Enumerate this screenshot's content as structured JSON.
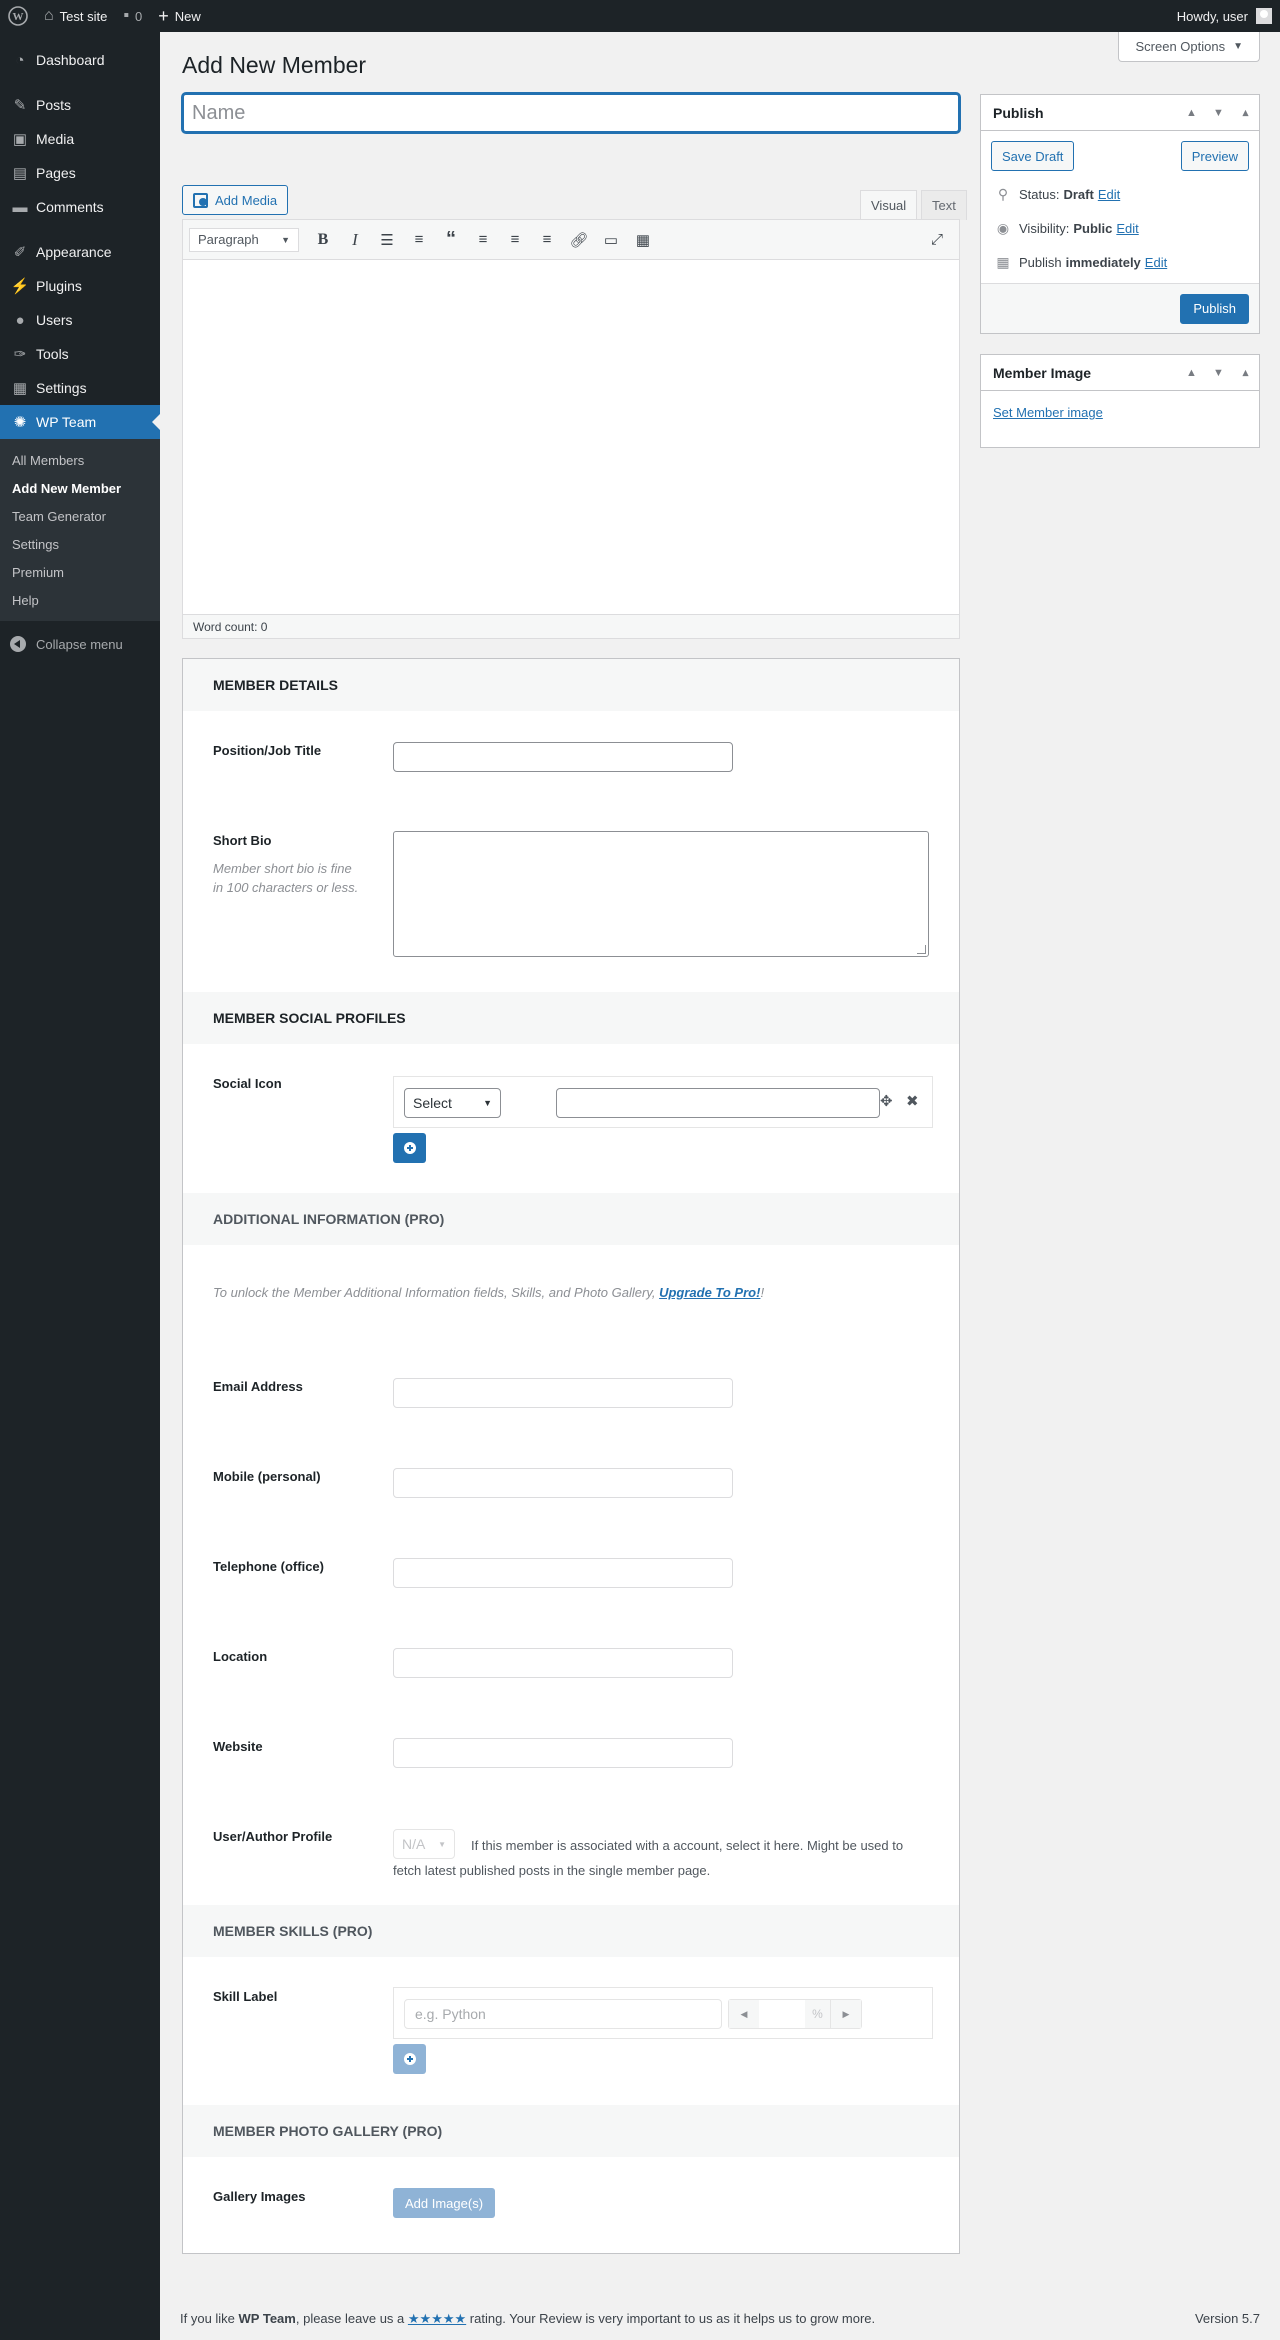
{
  "admin_bar": {
    "site_name": "Test site",
    "comments_count": "0",
    "new_label": "New",
    "howdy": "Howdy, user"
  },
  "menu": {
    "items": [
      {
        "label": "Dashboard",
        "icon": "dashboard-icon"
      },
      {
        "label": "Posts",
        "icon": "pin-icon"
      },
      {
        "label": "Media",
        "icon": "media-icon"
      },
      {
        "label": "Pages",
        "icon": "pages-icon"
      },
      {
        "label": "Comments",
        "icon": "comments-icon"
      },
      {
        "label": "Appearance",
        "icon": "brush-icon"
      },
      {
        "label": "Plugins",
        "icon": "plugin-icon"
      },
      {
        "label": "Users",
        "icon": "users-icon"
      },
      {
        "label": "Tools",
        "icon": "wrench-icon"
      },
      {
        "label": "Settings",
        "icon": "settings-icon"
      },
      {
        "label": "WP Team",
        "icon": "team-icon"
      }
    ],
    "submenu": [
      "All Members",
      "Add New Member",
      "Team Generator",
      "Settings",
      "Premium",
      "Help"
    ],
    "collapse": "Collapse menu",
    "active_color": "#2271b1"
  },
  "screen_options": "Screen Options",
  "page_title": "Add New Member",
  "title_placeholder": "Name",
  "editor": {
    "add_media": "Add Media",
    "tab_visual": "Visual",
    "tab_text": "Text",
    "format": "Paragraph",
    "word_count": "Word count: 0"
  },
  "publish": {
    "title": "Publish",
    "save_draft": "Save Draft",
    "preview": "Preview",
    "status_label": "Status:",
    "status_value": "Draft",
    "visibility_label": "Visibility:",
    "visibility_value": "Public",
    "publish_label": "Publish",
    "publish_value": "immediately",
    "edit": "Edit",
    "publish_button": "Publish"
  },
  "member_image": {
    "title": "Member Image",
    "link": "Set Member image"
  },
  "details": {
    "member_details_head": "MEMBER DETAILS",
    "position_label": "Position/Job Title",
    "short_bio_label": "Short Bio",
    "short_bio_desc": "Member short bio is fine in 100 characters or less.",
    "social_head": "MEMBER SOCIAL PROFILES",
    "social_label": "Social Icon",
    "social_select": "Select",
    "additional_head": "ADDITIONAL INFORMATION (PRO)",
    "pro_notice": "To unlock the Member Additional Information fields, Skills, and Photo Gallery, ",
    "pro_link": "Upgrade To Pro!",
    "pro_suffix": "!",
    "email_label": "Email Address",
    "mobile_label": "Mobile (personal)",
    "telephone_label": "Telephone (office)",
    "location_label": "Location",
    "website_label": "Website",
    "author_label": "User/Author Profile",
    "author_select": "N/A",
    "author_help": "If this member is associated with a account, select it here. Might be used to fetch latest published posts in the single member page.",
    "skills_head": "MEMBER SKILLS (PRO)",
    "skill_label": "Skill Label",
    "skill_placeholder": "e.g. Python",
    "skill_unit": "%",
    "gallery_head": "MEMBER PHOTO GALLERY (PRO)",
    "gallery_label": "Gallery Images",
    "add_images": "Add Image(s)"
  },
  "footer": {
    "text_before": "If you like ",
    "plugin": "WP Team",
    "text_mid": ", please leave us a ",
    "stars": "★★★★★",
    "text_after": " rating. Your Review is very important to us as it helps us to grow more.",
    "version": "Version 5.7"
  }
}
